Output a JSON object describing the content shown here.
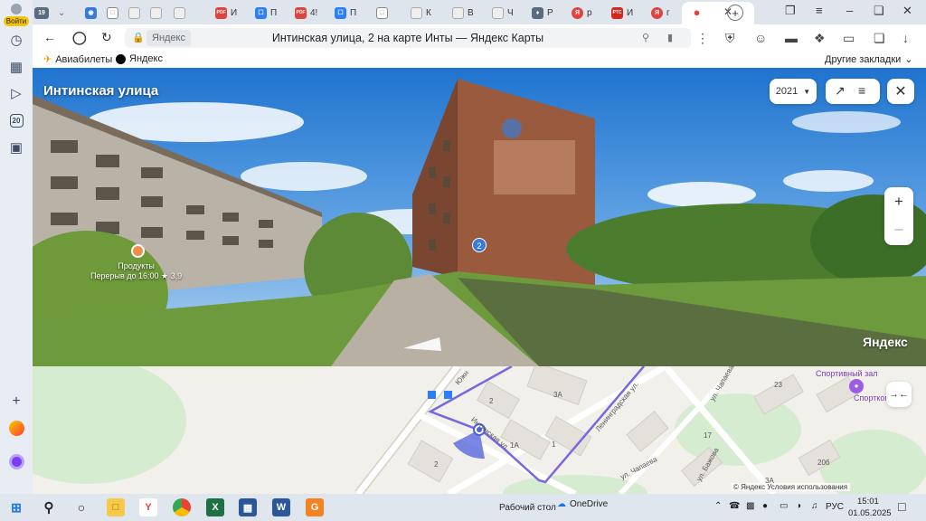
{
  "rail": {
    "login_label": "Войти",
    "tabs_count": "20"
  },
  "tabs": [
    {
      "label": "19",
      "color": "#5b6b80"
    },
    {
      "label": "",
      "color": "#3a7bd5"
    },
    {
      "label": "",
      "color": "#666"
    },
    {
      "label": "",
      "color": "#888"
    },
    {
      "label": "",
      "color": "#888"
    },
    {
      "label": "И",
      "color": "#e0443e",
      "fav": "PDF"
    },
    {
      "label": "П",
      "color": "#2d7ff9"
    },
    {
      "label": "4!",
      "color": "#e0443e",
      "fav": "PDF"
    },
    {
      "label": "П",
      "color": "#2d7ff9"
    },
    {
      "label": "",
      "color": "#666"
    },
    {
      "label": "К",
      "color": "#888"
    },
    {
      "label": "В",
      "color": "#888"
    },
    {
      "label": "Ч",
      "color": "#888"
    },
    {
      "label": "Р",
      "color": "#5b6b80"
    },
    {
      "label": "р",
      "color": "#e0443e"
    },
    {
      "label": "И",
      "color": "#d7261e",
      "fav": "РТС"
    },
    {
      "label": "г",
      "color": "#e0443e"
    }
  ],
  "address": {
    "host": "Яндекс",
    "title": "Интинская улица, 2 на карте Инты — Яндекс Карты"
  },
  "bookmarks": {
    "items": [
      "Авиабилеты",
      "Яндекс"
    ],
    "other": "Другие закладки"
  },
  "panorama": {
    "title": "Интинская улица",
    "year": "2021",
    "house_number": "2",
    "poi_name": "Продукты",
    "poi_info": "Перерыв до 16:00 ★ 3,9",
    "brand": "Яндекс"
  },
  "map": {
    "labels": [
      "Южн",
      "2",
      "3А",
      "Ленинградская ул.",
      "ул. Чапаева",
      "1А",
      "1",
      "ул. Бажова",
      "ул. Чапаева",
      "23",
      "17",
      "20б",
      "3А",
      "2",
      "Интинская ул."
    ],
    "poi_name": "Спортивный зал",
    "poi_name2": "Спортком",
    "footer": "© Яндекс  Условия использования"
  },
  "taskbar": {
    "desktop": "Рабочий стол",
    "onedrive": "OneDrive",
    "lang": "РУС",
    "time": "15:01",
    "date": "01.05.2025"
  }
}
